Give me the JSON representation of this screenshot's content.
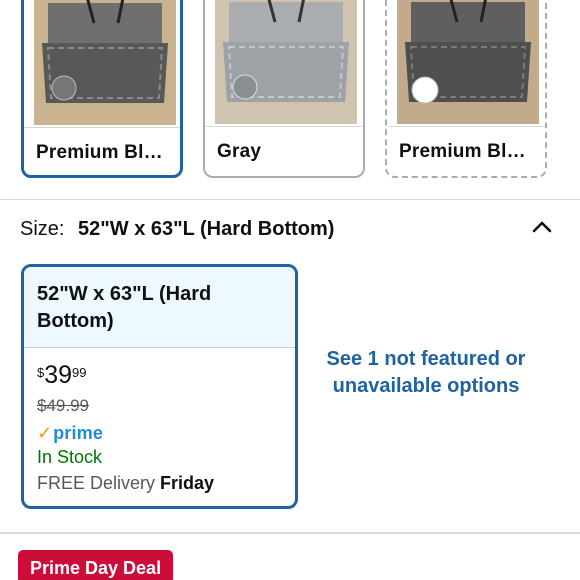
{
  "color_options": [
    {
      "label": "Premium Bl…",
      "selected": true,
      "style": "selected"
    },
    {
      "label": "Gray",
      "selected": false,
      "style": "normal"
    },
    {
      "label": "Premium Bl…",
      "selected": false,
      "style": "unavailable"
    }
  ],
  "size_header": {
    "label": "Size:",
    "value": "52\"W x 63\"L (Hard Bottom)"
  },
  "size_option": {
    "title": "52\"W x 63\"L (Hard Bottom)",
    "price_symbol": "$",
    "price_whole": "39",
    "price_fraction": "99",
    "list_price": "$49.99",
    "prime_label": "prime",
    "stock": "In Stock",
    "delivery_prefix": "FREE Delivery",
    "delivery_day": "Friday"
  },
  "see_more_link": "See 1 not featured or unavailable options",
  "deal_badge": "Prime Day Deal",
  "colors": {
    "accent_blue": "#2162a1",
    "selected_bg": "#edf8ff",
    "in_stock_green": "#007600",
    "prime_blue": "#1f8ed0",
    "deal_red": "#cc0c39"
  }
}
